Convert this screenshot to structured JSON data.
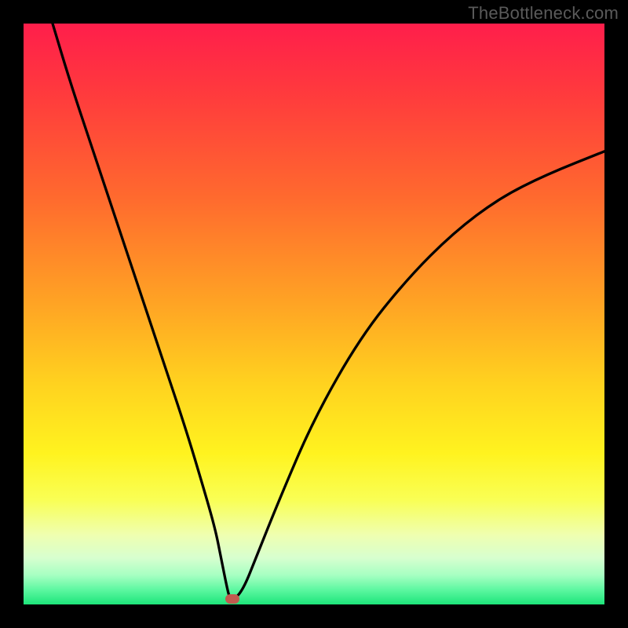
{
  "watermark": "TheBottleneck.com",
  "colors": {
    "frame": "#000000",
    "curve": "#000000",
    "marker": "#c15a4f",
    "gradient_stops": [
      {
        "offset": 0.0,
        "color": "#ff1e4b"
      },
      {
        "offset": 0.12,
        "color": "#ff3a3d"
      },
      {
        "offset": 0.3,
        "color": "#ff6a2e"
      },
      {
        "offset": 0.48,
        "color": "#ffa324"
      },
      {
        "offset": 0.62,
        "color": "#ffd21f"
      },
      {
        "offset": 0.74,
        "color": "#fff31f"
      },
      {
        "offset": 0.82,
        "color": "#f9ff55"
      },
      {
        "offset": 0.88,
        "color": "#efffb0"
      },
      {
        "offset": 0.92,
        "color": "#d7ffcf"
      },
      {
        "offset": 0.95,
        "color": "#a6ffc2"
      },
      {
        "offset": 0.975,
        "color": "#5cf7a0"
      },
      {
        "offset": 1.0,
        "color": "#1de57a"
      }
    ]
  },
  "chart_data": {
    "type": "line",
    "title": "",
    "xlabel": "",
    "ylabel": "",
    "xlim": [
      0,
      100
    ],
    "ylim": [
      0,
      100
    ],
    "series": [
      {
        "name": "bottleneck-curve",
        "x": [
          5,
          8,
          12,
          16,
          20,
          24,
          28,
          31,
          33,
          34,
          35,
          35.5,
          36.5,
          38,
          40,
          44,
          50,
          58,
          66,
          74,
          82,
          90,
          100
        ],
        "y": [
          100,
          90,
          78,
          66,
          54,
          42,
          30,
          20,
          13,
          8,
          3,
          1,
          1,
          3,
          8,
          18,
          32,
          46,
          56,
          64,
          70,
          74,
          78
        ]
      }
    ],
    "marker": {
      "x": 36,
      "y": 1,
      "shape": "rounded-pill",
      "color": "#c15a4f"
    },
    "notes": "Curve has a sharp minimum near x≈36 at bottom (green) and rises both sides toward red top. Values estimated from pixels; y=100 is top (most bottlenecked / red), y=0 is bottom (green)."
  }
}
